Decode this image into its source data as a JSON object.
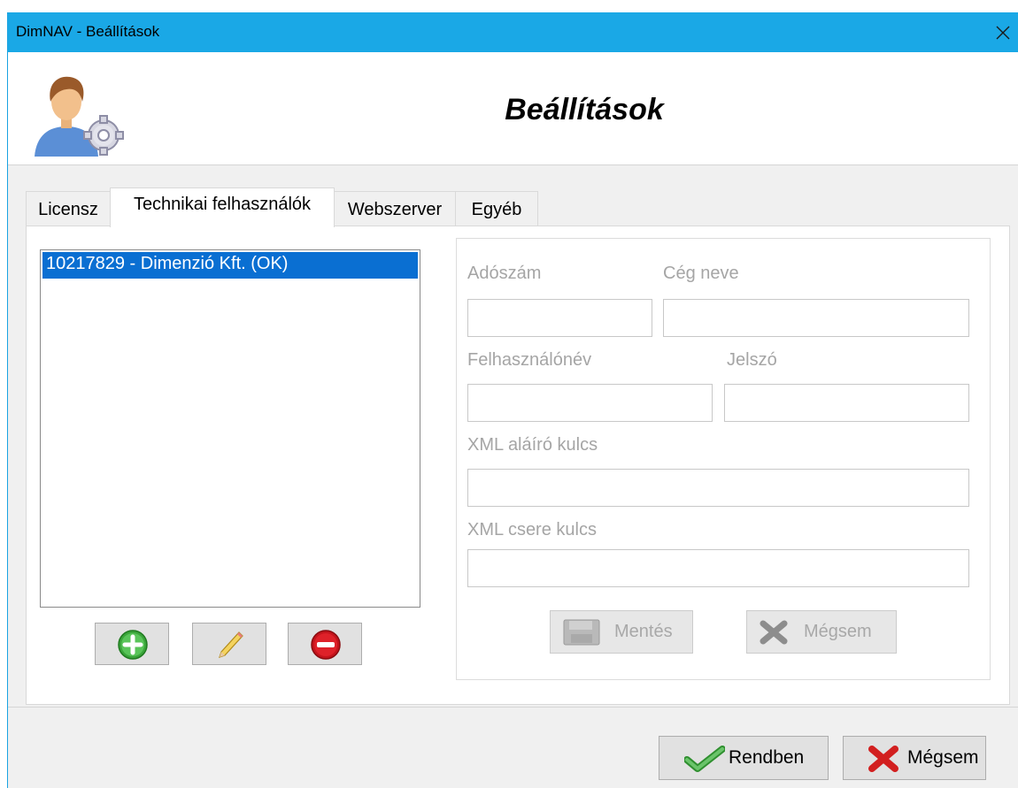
{
  "window": {
    "title": "DimNAV - Beállítások"
  },
  "header": {
    "heading": "Beállítások",
    "icon": "user-settings-icon"
  },
  "tabs": [
    {
      "label": "Licensz",
      "active": false
    },
    {
      "label": "Technikai felhasználók",
      "active": true
    },
    {
      "label": "Webszerver",
      "active": false
    },
    {
      "label": "Egyéb",
      "active": false
    }
  ],
  "user_list": {
    "items": [
      {
        "label": "10217829 - Dimenzió Kft. (OK)",
        "selected": true
      }
    ],
    "buttons": [
      {
        "name": "add-user-button",
        "icon": "add-icon"
      },
      {
        "name": "edit-user-button",
        "icon": "pencil-icon"
      },
      {
        "name": "remove-user-button",
        "icon": "remove-icon"
      }
    ]
  },
  "form": {
    "tax_number": {
      "label": "Adószám",
      "value": ""
    },
    "company_name": {
      "label": "Cég neve",
      "value": ""
    },
    "username": {
      "label": "Felhasználónév",
      "value": ""
    },
    "password": {
      "label": "Jelszó",
      "value": ""
    },
    "xml_signing_key": {
      "label": "XML aláíró kulcs",
      "value": ""
    },
    "xml_exchange_key": {
      "label": "XML csere kulcs",
      "value": ""
    },
    "save_label": "Mentés",
    "cancel_label": "Mégsem",
    "enabled": false
  },
  "footer": {
    "ok_label": "Rendben",
    "cancel_label": "Mégsem"
  },
  "colors": {
    "titlebar": "#1aa8e6",
    "selection": "#0a6fd2",
    "disabled_text": "#a5a5a5"
  }
}
